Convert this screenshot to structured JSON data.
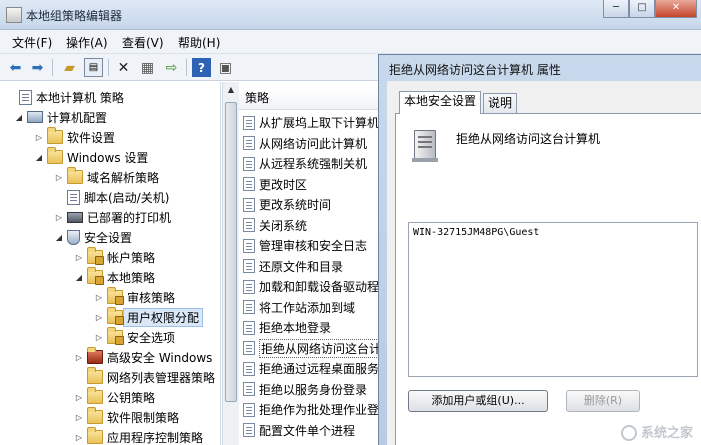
{
  "main_window": {
    "title": "本地组策略编辑器",
    "controls": {
      "minimize": "─",
      "maximize": "□",
      "close": "✕"
    }
  },
  "menu": [
    {
      "label": "文件(F)"
    },
    {
      "label": "操作(A)"
    },
    {
      "label": "查看(V)"
    },
    {
      "label": "帮助(H)"
    }
  ],
  "toolbar": [
    "back-icon",
    "forward-icon",
    "up-folder-icon",
    "show-hide-tree-icon",
    "delete-icon",
    "properties-icon",
    "export-list-icon",
    "help-icon",
    "view-icon"
  ],
  "tree": [
    {
      "label": "本地计算机 策略",
      "icon": "doc",
      "twisty": ""
    },
    {
      "label": "计算机配置",
      "icon": "computer",
      "twisty": "◢"
    },
    {
      "label": "软件设置",
      "icon": "folder",
      "twisty": "▷"
    },
    {
      "label": "Windows 设置",
      "icon": "folder",
      "twisty": "◢"
    },
    {
      "label": "域名解析策略",
      "icon": "folder",
      "twisty": "▷"
    },
    {
      "label": "脚本(启动/关机)",
      "icon": "doc",
      "twisty": ""
    },
    {
      "label": "已部署的打印机",
      "icon": "printer",
      "twisty": "▷"
    },
    {
      "label": "安全设置",
      "icon": "shield",
      "twisty": "◢"
    },
    {
      "label": "帐户策略",
      "icon": "lockfolder",
      "twisty": "▷"
    },
    {
      "label": "本地策略",
      "icon": "lockfolder",
      "twisty": "◢"
    },
    {
      "label": "审核策略",
      "icon": "lockfolder",
      "twisty": "▷"
    },
    {
      "label": "用户权限分配",
      "icon": "lockfolder",
      "twisty": "▷",
      "selected": true
    },
    {
      "label": "安全选项",
      "icon": "lockfolder",
      "twisty": "▷"
    },
    {
      "label": "高级安全 Windows",
      "icon": "fw",
      "twisty": "▷"
    },
    {
      "label": "网络列表管理器策略",
      "icon": "folder",
      "twisty": ""
    },
    {
      "label": "公钥策略",
      "icon": "folder",
      "twisty": "▷"
    },
    {
      "label": "软件限制策略",
      "icon": "folder",
      "twisty": "▷"
    },
    {
      "label": "应用程序控制策略",
      "icon": "folder",
      "twisty": "▷"
    }
  ],
  "policy_list": {
    "header": "策略",
    "rows": [
      "从扩展坞上取下计算机",
      "从网络访问此计算机",
      "从远程系统强制关机",
      "更改时区",
      "更改系统时间",
      "关闭系统",
      "管理审核和安全日志",
      "还原文件和目录",
      "加载和卸载设备驱动程",
      "将工作站添加到域",
      "拒绝本地登录",
      "拒绝从网络访问这台计",
      "拒绝通过远程桌面服务",
      "拒绝以服务身份登录",
      "拒绝作为批处理作业登",
      "配置文件单个进程"
    ],
    "highlighted_index": 11
  },
  "dialog": {
    "title": "拒绝从网络访问这台计算机 属性",
    "tabs": [
      "本地安全设置",
      "说明"
    ],
    "active_tab": 0,
    "policy_name": "拒绝从网络访问这台计算机",
    "members": [
      "WIN-32715JM48PG\\Guest"
    ],
    "buttons": {
      "add": "添加用户或组(U)...",
      "remove": "删除(R)"
    }
  },
  "watermark": "系统之家"
}
